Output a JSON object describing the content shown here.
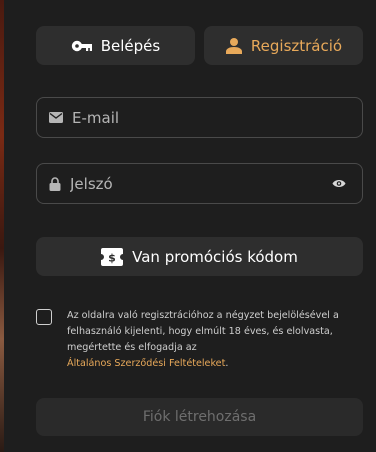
{
  "tabs": {
    "login_label": "Belépés",
    "register_label": "Regisztráció",
    "active": "register"
  },
  "form": {
    "email_placeholder": "E-mail",
    "password_placeholder": "Jelszó",
    "promo_label": "Van promóciós kódom",
    "consent_text": "Az oldalra való regisztrációhoz a négyzet bejelölésével a felhasználó kijelenti, hogy elmúlt 18 éves, és elolvasta, megértette és elfogadja az",
    "terms_link": "Általános Szerződési Feltételeket",
    "terms_suffix": ".",
    "submit_label": "Fiók létrehozása"
  },
  "icons": {
    "login": "key-icon",
    "register": "user-icon",
    "email": "envelope-icon",
    "password": "lock-icon",
    "visibility": "eye-icon",
    "promo": "promo-ticket-icon"
  },
  "colors": {
    "background": "#1e1e1e",
    "accent": "#e8a95a",
    "button_bg": "#2e2e2e",
    "disabled_text": "#6e6e6e"
  }
}
